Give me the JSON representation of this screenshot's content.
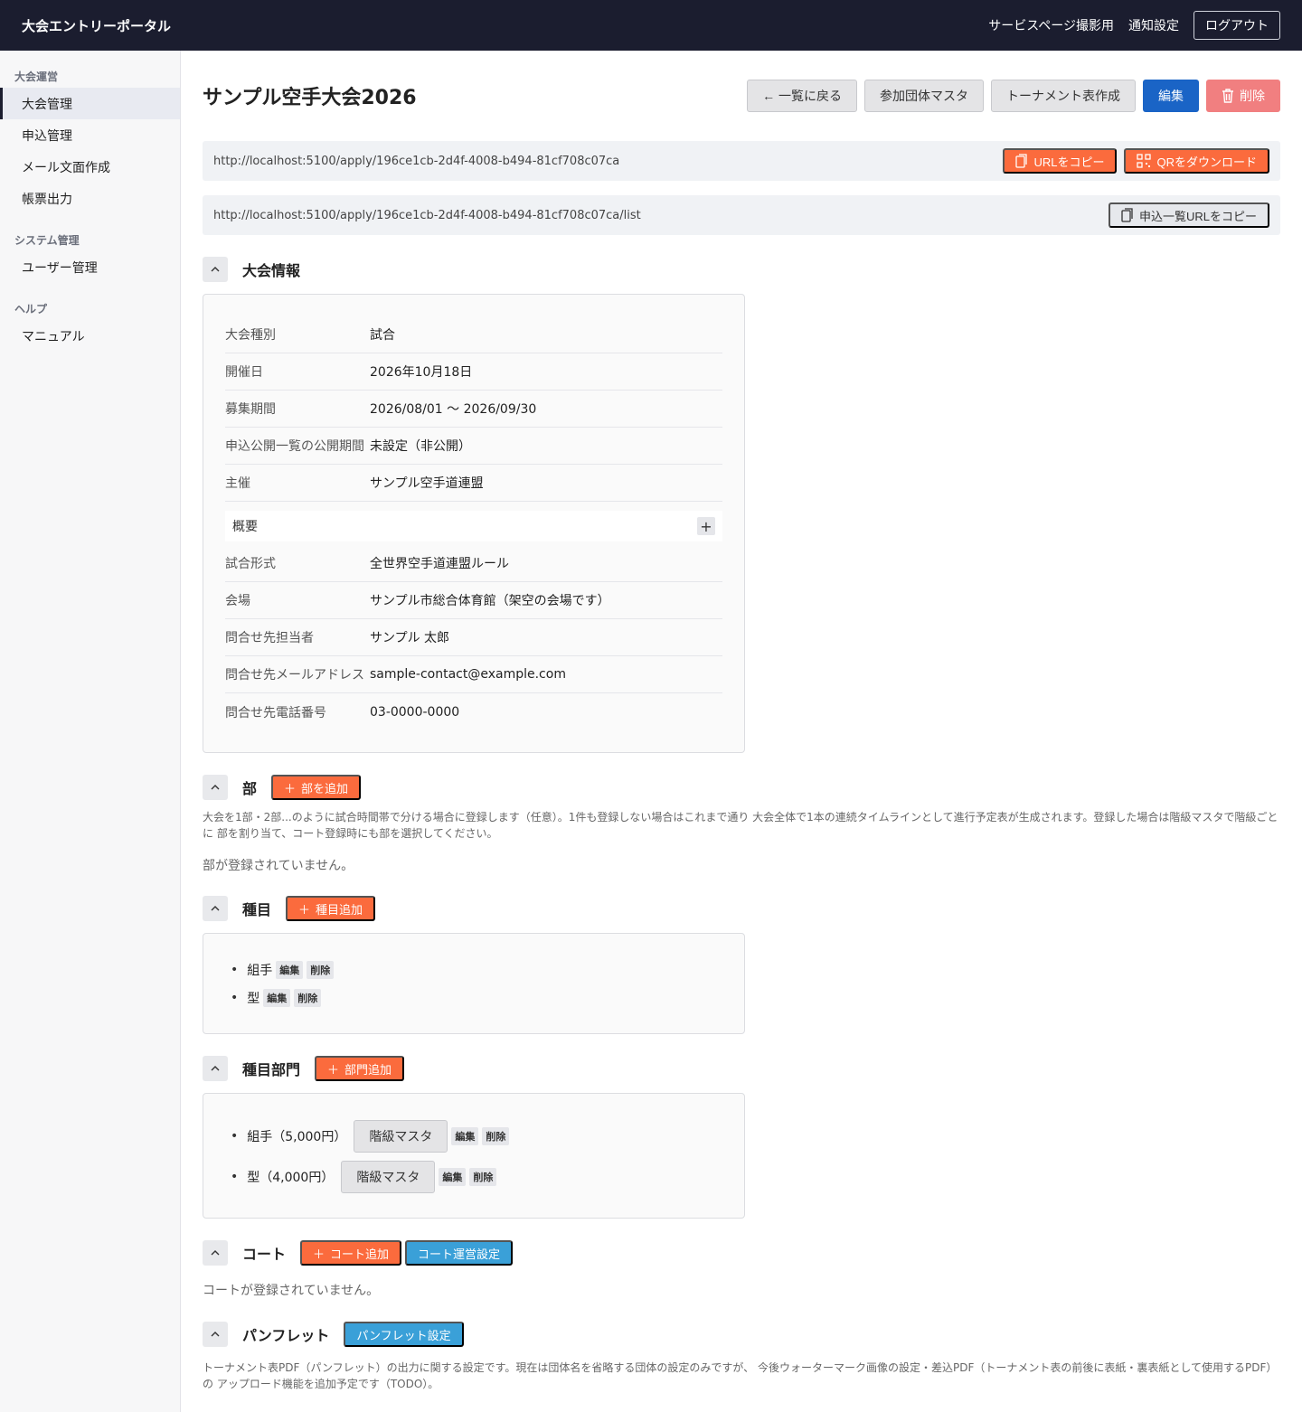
{
  "header": {
    "brand": "大会エントリーポータル",
    "links": [
      "サービスページ撮影用",
      "通知設定"
    ],
    "logout": "ログアウト"
  },
  "sidebar": {
    "groups": [
      {
        "title": "大会運営",
        "items": [
          "大会管理",
          "申込管理",
          "メール文面作成",
          "帳票出力"
        ]
      },
      {
        "title": "システム管理",
        "items": [
          "ユーザー管理"
        ]
      },
      {
        "title": "ヘルプ",
        "items": [
          "マニュアル"
        ]
      }
    ],
    "active": "大会管理"
  },
  "page": {
    "title": "サンプル空手大会2026",
    "actions": {
      "back": "← 一覧に戻る",
      "teams": "参加団体マスタ",
      "tournament": "トーナメント表作成",
      "edit": "編集",
      "delete": "削除"
    }
  },
  "urls": {
    "apply_url": "http://localhost:5100/apply/196ce1cb-2d4f-4008-b494-81cf708c07ca",
    "copy_label": "URLをコピー",
    "qr_label": "QRをダウンロード",
    "list_url": "http://localhost:5100/apply/196ce1cb-2d4f-4008-b494-81cf708c07ca/list",
    "copy_list_label": "申込一覧URLをコピー"
  },
  "info": {
    "title": "大会情報",
    "rows": [
      {
        "label": "大会種別",
        "value": "試合"
      },
      {
        "label": "開催日",
        "value": "2026年10月18日"
      },
      {
        "label": "募集期間",
        "value": "2026/08/01 〜 2026/09/30"
      },
      {
        "label": "申込公開一覧の公開期間",
        "value": "未設定（非公開）"
      },
      {
        "label": "主催",
        "value": "サンプル空手道連盟"
      }
    ],
    "summary": "概要",
    "rows2": [
      {
        "label": "試合形式",
        "value": "全世界空手道連盟ルール"
      },
      {
        "label": "会場",
        "value": "サンプル市総合体育館（架空の会場です）"
      },
      {
        "label": "問合せ先担当者",
        "value": "サンプル 太郎"
      },
      {
        "label": "問合せ先メールアドレス",
        "value": "sample-contact@example.com"
      },
      {
        "label": "問合せ先電話番号",
        "value": "03-0000-0000"
      }
    ]
  },
  "bu": {
    "title": "部",
    "add": "部を追加",
    "desc": "大会を1部・2部...のように試合時間帯で分ける場合に登録します（任意）。1件も登録しない場合はこれまで通り 大会全体で1本の連続タイムラインとして進行予定表が生成されます。登録した場合は階級マスタで階級ごとに 部を割り当て、コート登録時にも部を選択してください。",
    "empty": "部が登録されていません。"
  },
  "events": {
    "title": "種目",
    "add": "種目追加",
    "items": [
      "組手",
      "型"
    ],
    "edit": "編集",
    "delete": "削除"
  },
  "divisions": {
    "title": "種目部門",
    "add": "部門追加",
    "items": [
      "組手（5,000円）",
      "型（4,000円）"
    ],
    "grade": "階級マスタ",
    "edit": "編集",
    "delete": "削除"
  },
  "courts": {
    "title": "コート",
    "add": "コート追加",
    "settings": "コート運営設定",
    "empty": "コートが登録されていません。"
  },
  "pamphlet": {
    "title": "パンフレット",
    "settings": "パンフレット設定",
    "desc": "トーナメント表PDF（パンフレット）の出力に関する設定です。現在は団体名を省略する団体の設定のみですが、 今後ウォーターマーク画像の設定・差込PDF（トーナメント表の前後に表紙・裏表紙として使用するPDF）の アップロード機能を追加予定です（TODO）。"
  }
}
